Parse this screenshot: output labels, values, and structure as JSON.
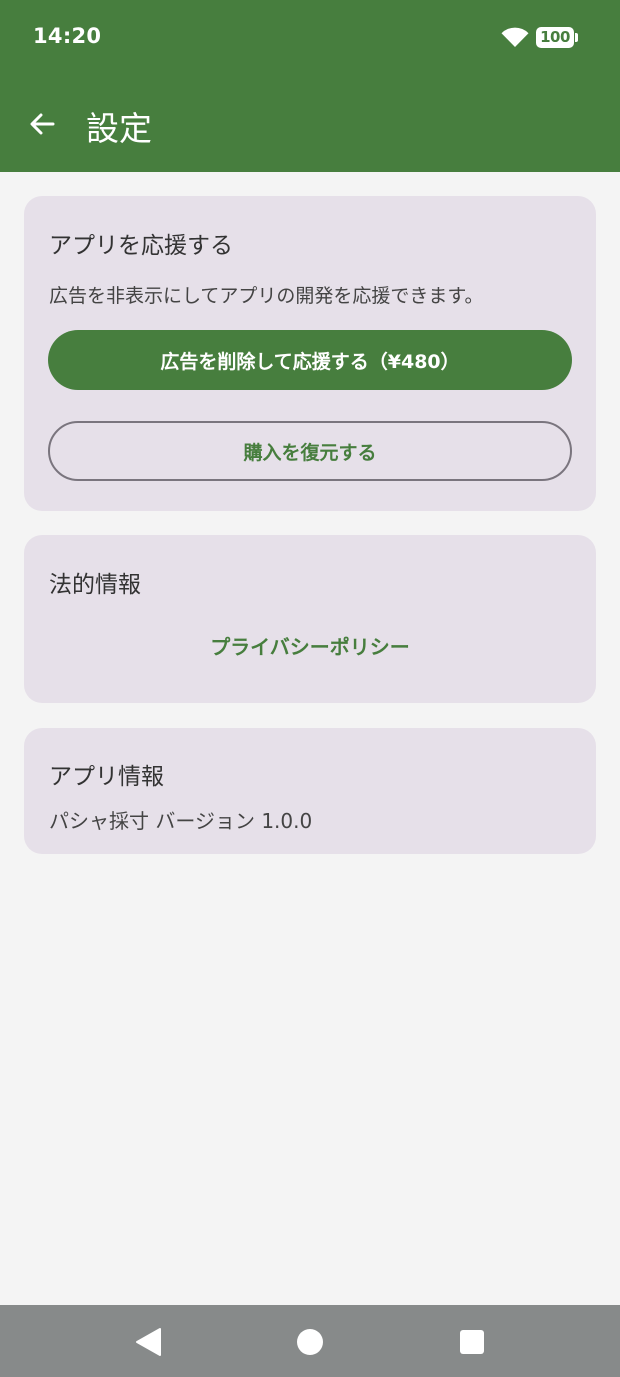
{
  "status_bar": {
    "time": "14:20",
    "battery": "100",
    "wifi_icon": "wifi-icon"
  },
  "app_bar": {
    "back_icon": "arrow-back-icon",
    "title": "設定"
  },
  "support_card": {
    "title": "アプリを応援する",
    "description": "広告を非表示にしてアプリの開発を応援できます。",
    "remove_ads_button": "広告を削除して応援する（¥480）",
    "restore_button": "購入を復元する"
  },
  "legal_card": {
    "title": "法的情報",
    "privacy_policy_button": "プライバシーポリシー"
  },
  "about_card": {
    "title": "アプリ情報",
    "version_text": "パシャ採寸 バージョン 1.0.0"
  },
  "nav_bar": {
    "back_icon": "triangle-back-icon",
    "home_icon": "circle-home-icon",
    "recents_icon": "square-recents-icon"
  },
  "colors": {
    "primary": "#477e3e",
    "card_background": "#e6e0e9",
    "page_background": "#f4f4f4",
    "nav_bar": "#878a8a"
  }
}
